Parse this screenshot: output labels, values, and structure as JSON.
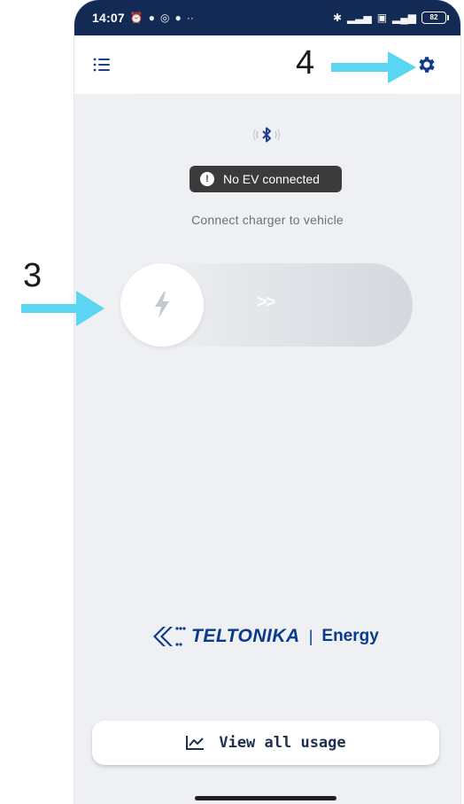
{
  "status_bar": {
    "time": "14:07",
    "battery": "82",
    "left_icons": [
      "alarm-icon",
      "messenger-icon",
      "instagram-icon",
      "apple-icon",
      "more-icon"
    ],
    "right_icons": [
      "bluetooth-icon",
      "signal-icon",
      "sim-icon",
      "lte-signal-icon",
      "battery-icon"
    ]
  },
  "app_bar": {
    "menu_icon": "menu-icon",
    "settings_icon": "gear-icon"
  },
  "main": {
    "bluetooth_icon": "bluetooth-icon",
    "status_badge": "No EV connected",
    "instruction": "Connect charger to vehicle",
    "slider_chevrons": ">>"
  },
  "brand": {
    "name": "TELTONIKA",
    "separator": "|",
    "product": "Energy"
  },
  "footer": {
    "usage_button": "View all usage"
  },
  "annotations": {
    "label_3": "3",
    "label_4": "4",
    "color": "#5bd6f2"
  },
  "colors": {
    "status_bar": "#132a55",
    "accent": "#0a3a8c",
    "screen_bg": "#eef0f3"
  }
}
